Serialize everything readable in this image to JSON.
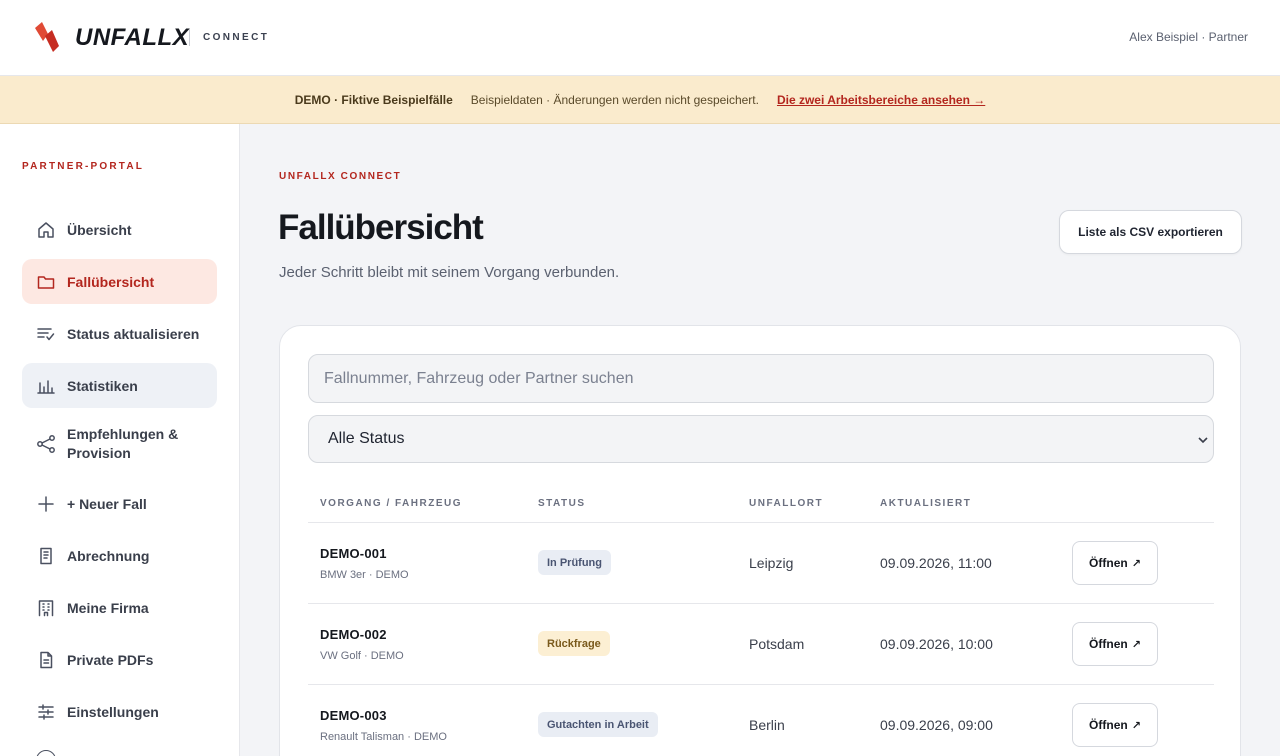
{
  "header": {
    "brand_name": "UNFALLX",
    "brand_sub": "CONNECT",
    "user": "Alex Beispiel · Partner",
    "colors": {
      "brand_red": "#d8362a",
      "brand_red_dark": "#b3261e"
    }
  },
  "banner": {
    "title": "DEMO · Fiktive Beispielfälle",
    "text": "Beispieldaten · Änderungen werden nicht gespeichert.",
    "link": "Die zwei Arbeitsbereiche ansehen →"
  },
  "sidebar": {
    "heading": "PARTNER-PORTAL",
    "items": [
      {
        "label": "Übersicht",
        "icon": "home-icon"
      },
      {
        "label": "Fallübersicht",
        "icon": "folder-icon",
        "active": true
      },
      {
        "label": "Status aktualisieren",
        "icon": "list-check-icon"
      },
      {
        "label": "Statistiken",
        "icon": "bar-chart-icon"
      },
      {
        "label": "Empfehlungen & Provision",
        "icon": "share-icon"
      },
      {
        "label": "+ Neuer Fall",
        "icon": "plus-icon"
      },
      {
        "label": "Abrechnung",
        "icon": "receipt-icon"
      },
      {
        "label": "Meine Firma",
        "icon": "building-icon"
      },
      {
        "label": "Private PDFs",
        "icon": "document-icon"
      },
      {
        "label": "Einstellungen",
        "icon": "sliders-icon"
      }
    ]
  },
  "main": {
    "eyebrow": "UNFALLX CONNECT",
    "title": "Fallübersicht",
    "subtitle": "Jeder Schritt bleibt mit seinem Vorgang verbunden.",
    "export_label": "Liste als CSV exportieren",
    "search_placeholder": "Fallnummer, Fahrzeug oder Partner suchen",
    "status_filter": "Alle Status",
    "columns": [
      "VORGANG / FAHRZEUG",
      "STATUS",
      "UNFALLORT",
      "AKTUALISIERT"
    ],
    "rows": [
      {
        "id": "DEMO-001",
        "vehicle": "BMW 3er · DEMO",
        "status": "In Prüfung",
        "place": "Leipzig",
        "updated": "09.09.2026, 11:00",
        "action": "Öffnen"
      },
      {
        "id": "DEMO-002",
        "vehicle": "VW Golf · DEMO",
        "status": "Rückfrage",
        "place": "Potsdam",
        "updated": "09.09.2026, 10:00",
        "action": "Öffnen"
      },
      {
        "id": "DEMO-003",
        "vehicle": "Renault Talisman · DEMO",
        "status": "Gutachten in Arbeit",
        "place": "Berlin",
        "updated": "09.09.2026, 09:00",
        "action": "Öffnen"
      }
    ]
  }
}
